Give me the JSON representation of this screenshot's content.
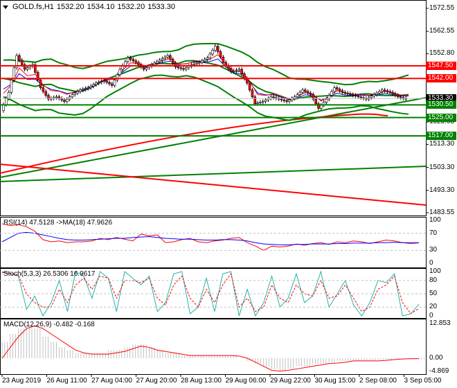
{
  "header": {
    "symbol": "GOLD.fs,H1",
    "open": "1532.20",
    "high": "1534.10",
    "low": "1532.20",
    "close": "1533.30"
  },
  "colors": {
    "support": "#008000",
    "resistance": "#ff0000",
    "current": "#000000",
    "rsi": "#ff0000",
    "rsi_ma": "#0000ff",
    "stoch_main": "#20b2aa",
    "stoch_signal": "#ff0000",
    "macd_hist": "#c0c0c0",
    "macd_signal": "#ff0000"
  },
  "price_axis": {
    "ticks": [
      "1572.55",
      "1562.55",
      "1552.80",
      "1523.05",
      "1513.30",
      "1503.30",
      "1493.30",
      "1483.55"
    ],
    "range": [
      1483.55,
      1572.55
    ]
  },
  "levels": [
    {
      "label": "1547.50",
      "value": 1547.5,
      "kind": "resistance"
    },
    {
      "label": "1542.00",
      "value": 1542.0,
      "kind": "resistance"
    },
    {
      "label": "1533.30",
      "value": 1533.3,
      "kind": "current"
    },
    {
      "label": "1530.50",
      "value": 1530.5,
      "kind": "support"
    },
    {
      "label": "1525.00",
      "value": 1525.0,
      "kind": "support"
    },
    {
      "label": "1517.00",
      "value": 1517.0,
      "kind": "support"
    }
  ],
  "chart_data": {
    "type": "line",
    "close_series": [
      1528,
      1536,
      1552,
      1546,
      1548,
      1538,
      1533,
      1534,
      1532,
      1535,
      1537,
      1538,
      1540,
      1541,
      1539,
      1546,
      1551,
      1549,
      1546,
      1548,
      1550,
      1552,
      1547,
      1546,
      1548,
      1549,
      1551,
      1556,
      1549,
      1545,
      1546,
      1540,
      1531,
      1532,
      1534,
      1533,
      1532,
      1534,
      1537,
      1535,
      1529,
      1533,
      1538,
      1536,
      1535,
      1534,
      1533,
      1535,
      1537,
      1536,
      1534,
      1533
    ],
    "rsi": {
      "label": "RSI(14) 47.5128  ->MA(18) 47.9626",
      "ticks": [
        "100",
        "70",
        "30",
        "0"
      ],
      "values": [
        92,
        88,
        90,
        85,
        75,
        55,
        50,
        52,
        48,
        50,
        50,
        52,
        58,
        55,
        60,
        56,
        52,
        68,
        64,
        66,
        48,
        50,
        55,
        58,
        50,
        48,
        52,
        54,
        58,
        60,
        48,
        40,
        30,
        40,
        38,
        40,
        45,
        42,
        46,
        48,
        44,
        50,
        48,
        52,
        50,
        46,
        50,
        54,
        52,
        48,
        46,
        47.5
      ],
      "ma": [
        50,
        60,
        70,
        72,
        70,
        66,
        62,
        58,
        55,
        54,
        54,
        55,
        56,
        57,
        58,
        58,
        60,
        61,
        62,
        60,
        58,
        57,
        56,
        56,
        55,
        54,
        54,
        55,
        55,
        54,
        52,
        48,
        45,
        44,
        43,
        43,
        44,
        44,
        45,
        45,
        45,
        46,
        46,
        47,
        47,
        47,
        48,
        48,
        49,
        48,
        48,
        48
      ]
    },
    "stoch": {
      "label": "Stoch(5,3,3) 26.5306 16.9617",
      "ticks": [
        "100",
        "80",
        "50",
        "20",
        "0"
      ],
      "main": [
        100,
        95,
        90,
        15,
        45,
        0,
        30,
        80,
        10,
        100,
        90,
        40,
        100,
        85,
        10,
        100,
        85,
        70,
        90,
        10,
        30,
        95,
        100,
        5,
        20,
        85,
        10,
        95,
        100,
        0,
        60,
        0,
        30,
        90,
        20,
        40,
        95,
        30,
        45,
        100,
        20,
        50,
        80,
        25,
        0,
        30,
        80,
        75,
        95,
        0,
        5,
        26.5
      ],
      "signal": [
        98,
        96,
        92,
        50,
        30,
        20,
        20,
        60,
        30,
        70,
        85,
        60,
        90,
        85,
        40,
        80,
        80,
        75,
        85,
        40,
        25,
        70,
        90,
        40,
        20,
        60,
        30,
        70,
        95,
        20,
        40,
        10,
        20,
        70,
        40,
        30,
        70,
        50,
        45,
        80,
        40,
        45,
        70,
        40,
        10,
        20,
        60,
        70,
        90,
        30,
        5,
        17
      ]
    },
    "macd": {
      "label": "MACD(12,26,9) -0.482 -0.168",
      "ticks": [
        "12.853",
        "0.00",
        "-4.869"
      ],
      "hist": [
        6,
        9,
        11,
        12,
        11,
        8,
        6,
        4,
        3,
        2,
        2,
        2,
        2,
        3,
        3,
        4,
        5,
        5,
        4,
        3,
        2,
        2,
        1,
        1,
        1,
        1,
        1,
        1,
        1,
        0,
        -1,
        -2,
        -3,
        -4,
        -4.5,
        -4,
        -3,
        -3,
        -2,
        -2,
        -1.5,
        -1,
        -1,
        -1,
        -1,
        -1,
        -0.5,
        -0.5,
        -0.3,
        -0.2,
        -0.4,
        -0.482
      ],
      "signal": [
        0,
        4,
        8,
        11,
        12,
        11,
        9,
        7,
        5,
        3,
        2,
        1.5,
        1.5,
        1.5,
        2,
        2.5,
        3.5,
        4.5,
        4,
        3,
        2.5,
        2,
        1.5,
        1,
        1,
        1,
        1,
        1,
        1,
        0.8,
        0,
        -1.5,
        -3,
        -4.5,
        -4.8,
        -4.5,
        -4,
        -3.5,
        -3,
        -2.5,
        -2,
        -1.8,
        -1.5,
        -1,
        -1,
        -1,
        -1,
        -0.8,
        -0.5,
        -0.3,
        -0.2,
        -0.168
      ]
    }
  },
  "time_axis": [
    "23 Aug 2019",
    "26 Aug 11:00",
    "27 Aug 04:00",
    "27 Aug 20:00",
    "28 Aug 13:00",
    "29 Aug 06:00",
    "29 Aug 22:00",
    "30 Aug 15:00",
    "2 Sep 08:00",
    "3 Sep 05:00"
  ]
}
